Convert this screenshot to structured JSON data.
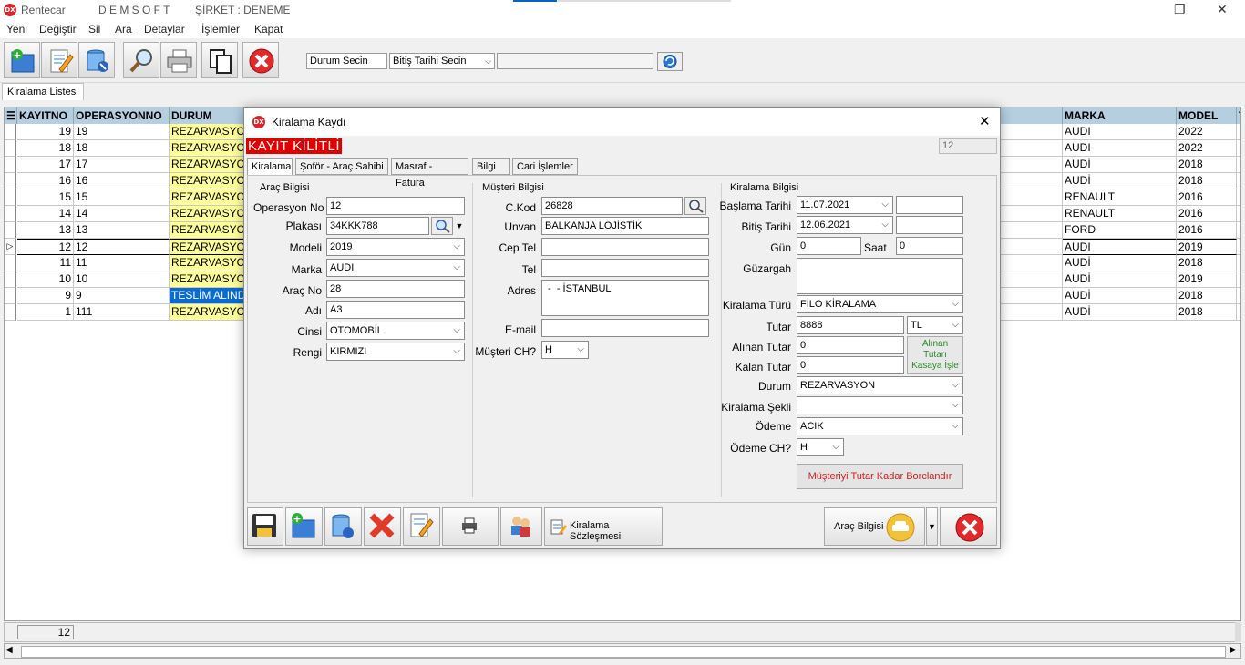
{
  "titlebar": {
    "app": "Rentecar",
    "company": "D E M S O F T",
    "sirket": "ŞİRKET : DENEME"
  },
  "menu": [
    "Yeni",
    "Değiştir",
    "Sil",
    "Ara",
    "Detaylar",
    "İşlemler",
    "Kapat"
  ],
  "toolbar": {
    "durum_combo": "Durum Secin",
    "bitis_combo": "Bitiş Tarihi Secin",
    "buttons": [
      "new-icon",
      "edit-icon",
      "delete-icon",
      "search-icon",
      "print-icon",
      "copy-icon",
      "close-icon"
    ]
  },
  "list_tab": "Kiralama Listesi",
  "grid": {
    "columns": {
      "kayitno": "KAYITNO",
      "operasyonno": "OPERASYONNO",
      "durum": "DURUM",
      "marka": "MARKA",
      "model": "MODEL",
      "extra": "T"
    },
    "rows": [
      {
        "kayitno": "19",
        "operasyonno": "19",
        "durum": "REZARVASYON",
        "marka": "AUDI",
        "model": "2022"
      },
      {
        "kayitno": "18",
        "operasyonno": "18",
        "durum": "REZARVASYON",
        "marka": "AUDI",
        "model": "2022"
      },
      {
        "kayitno": "17",
        "operasyonno": "17",
        "durum": "REZARVASYON",
        "marka": "AUDİ",
        "model": "2018"
      },
      {
        "kayitno": "16",
        "operasyonno": "16",
        "durum": "REZARVASYON",
        "marka": "AUDİ",
        "model": "2018"
      },
      {
        "kayitno": "15",
        "operasyonno": "15",
        "durum": "REZARVASYON",
        "marka": "RENAULT",
        "model": "2016"
      },
      {
        "kayitno": "14",
        "operasyonno": "14",
        "durum": "REZARVASYON",
        "marka": "RENAULT",
        "model": "2016"
      },
      {
        "kayitno": "13",
        "operasyonno": "13",
        "durum": "REZARVASYON",
        "marka": "FORD",
        "model": "2016"
      },
      {
        "kayitno": "12",
        "operasyonno": "12",
        "durum": "REZARVASYON",
        "marka": "AUDI",
        "model": "2019"
      },
      {
        "kayitno": "11",
        "operasyonno": "11",
        "durum": "REZARVASYON",
        "marka": "AUDİ",
        "model": "2018"
      },
      {
        "kayitno": "10",
        "operasyonno": "10",
        "durum": "REZARVASYON",
        "marka": "AUDİ",
        "model": "2019"
      },
      {
        "kayitno": "9",
        "operasyonno": "9",
        "durum": "TESLİM ALINDI",
        "marka": "AUDİ",
        "model": "2018"
      },
      {
        "kayitno": "1",
        "operasyonno": "111",
        "durum": "REZARVASYON",
        "marka": "AUDİ",
        "model": "2018"
      }
    ],
    "footer_count": "12"
  },
  "colors": {
    "yellow": "#ffff99",
    "blue_sel": "#0a6cd0",
    "header": "#b5cfe1",
    "locked": "#e00000"
  },
  "dialog": {
    "title": "Kiralama Kaydı",
    "locked_banner": "KAYIT KİLİTLİ",
    "record_id": "12",
    "tabs": [
      "Kiralama",
      "Şoför - Araç Sahibi",
      "Masraf - Fatura",
      "Bilgi",
      "Cari İşlemler"
    ],
    "arac": {
      "group": "Araç Bilgisi",
      "operasyon_no_label": "Operasyon No",
      "operasyon_no": "12",
      "plaka_label": "Plakası",
      "plaka": "34KKK788",
      "model_label": "Modeli",
      "model": "2019",
      "marka_label": "Marka",
      "marka": "AUDI",
      "arac_no_label": "Araç No",
      "arac_no": "28",
      "adi_label": "Adı",
      "adi": "A3",
      "cinsi_label": "Cinsi",
      "cinsi": "OTOMOBİL",
      "rengi_label": "Rengi",
      "rengi": "KIRMIZI"
    },
    "musteri": {
      "group": "Müşteri Bilgisi",
      "ckod_label": "C.Kod",
      "ckod": "26828",
      "unvan_label": "Unvan",
      "unvan": "BALKANJA LOJİSTİK",
      "ceptel_label": "Cep Tel",
      "ceptel": "",
      "tel_label": "Tel",
      "tel": "",
      "adres_label": "Adres",
      "adres": " -  - İSTANBUL",
      "email_label": "E-mail",
      "email": "",
      "ch_label": "Müşteri CH?",
      "ch": "H"
    },
    "kiralama": {
      "group": "Kiralama Bilgisi",
      "baslama_label": "Başlama Tarihi",
      "baslama": "11.07.2021",
      "bitis_label": "Bitiş Tarihi",
      "bitis": "12.06.2021",
      "gun_label": "Gün",
      "gun": "0",
      "saat_label": "Saat",
      "saat": "0",
      "guzargah_label": "Güzargah",
      "turu_label": "Kiralama Türü",
      "turu": "FİLO KİRALAMA",
      "tutar_label": "Tutar",
      "tutar": "8888",
      "para": "TL",
      "alinan_label": "Alınan Tutar",
      "alinan": "0",
      "kalan_label": "Kalan Tutar",
      "kalan": "0",
      "kasa_btn": [
        "Alınan",
        "Tutarı",
        "Kasaya İşle"
      ],
      "durum_label": "Durum",
      "durum": "REZARVASYON",
      "sekli_label": "Kiralama Şekli",
      "sekli": "",
      "odeme_label": "Ödeme",
      "odeme": "ACIK",
      "odeme_ch_label": "Ödeme CH?",
      "odeme_ch": "H",
      "borc_btn": "Müşteriyi Tutar Kadar Borclandır"
    },
    "bottom": {
      "sozlesme": "Kiralama Sözleşmesi",
      "arac_bilgisi": "Araç Bilgisi"
    }
  }
}
